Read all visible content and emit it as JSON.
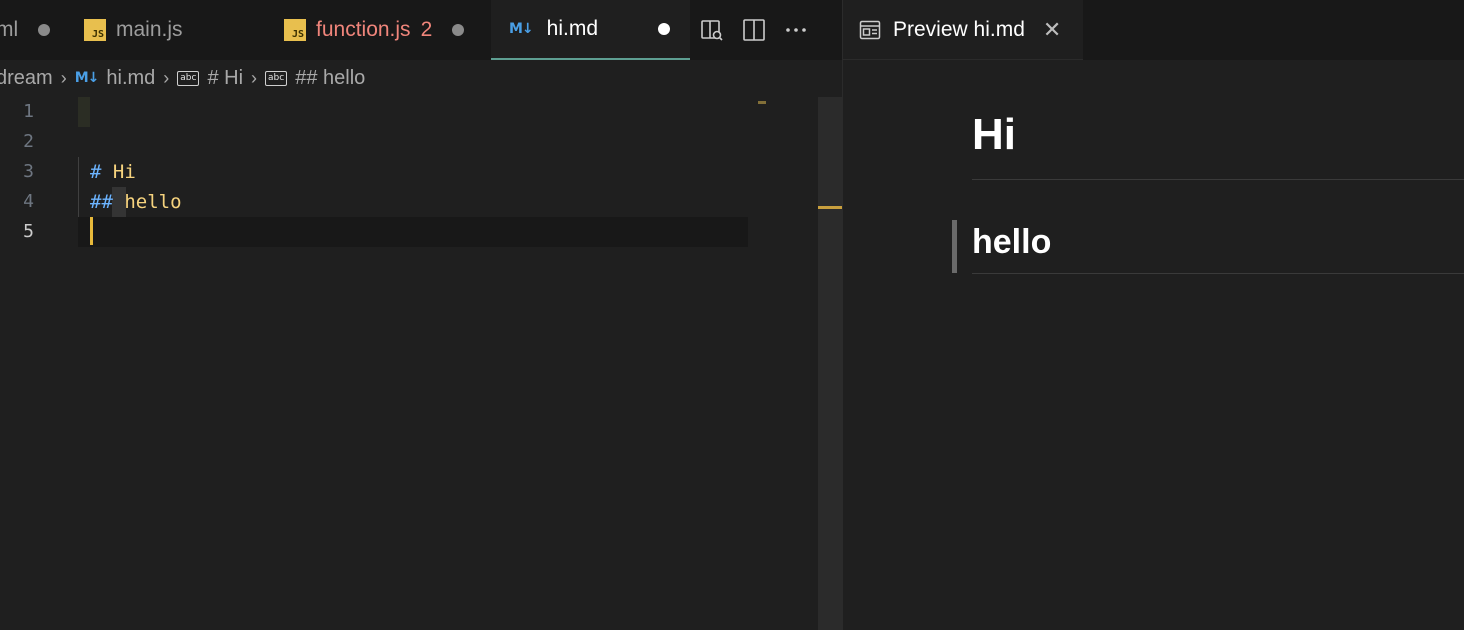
{
  "tabs": [
    {
      "label": "ml",
      "modified": true
    },
    {
      "label": "main.js",
      "icon": "js-icon"
    },
    {
      "label": "function.js",
      "problems": "2",
      "modified": true,
      "icon": "js-icon",
      "color": "#f0857b"
    },
    {
      "label": "hi.md",
      "modified": true,
      "active": true,
      "icon": "markdown-icon"
    }
  ],
  "breadcrumb": {
    "folder": "dream",
    "file": "hi.md",
    "symbol1": "# Hi",
    "symbol2": "## hello",
    "symbol_icon_text": "abc"
  },
  "editor": {
    "line_numbers": [
      "1",
      "2",
      "3",
      "4",
      "5"
    ],
    "active_line": "5",
    "lines": [
      {
        "hash": "",
        "text": ""
      },
      {
        "hash": "",
        "text": ""
      },
      {
        "hash": "#",
        "text": " Hi"
      },
      {
        "hash": "##",
        "text": " hello"
      },
      {
        "hash": "",
        "text": ""
      }
    ]
  },
  "preview": {
    "tab_label": "Preview hi.md",
    "h1": "Hi",
    "h2": "hello"
  },
  "icons": {
    "md": "M↓",
    "js": "JS"
  },
  "colors": {
    "accent_tab_border": "#5e9f92",
    "cursor": "#e8b93a",
    "heading_text": "#f6d37e",
    "hash": "#6cb4ff",
    "error_tab": "#f0857b"
  }
}
